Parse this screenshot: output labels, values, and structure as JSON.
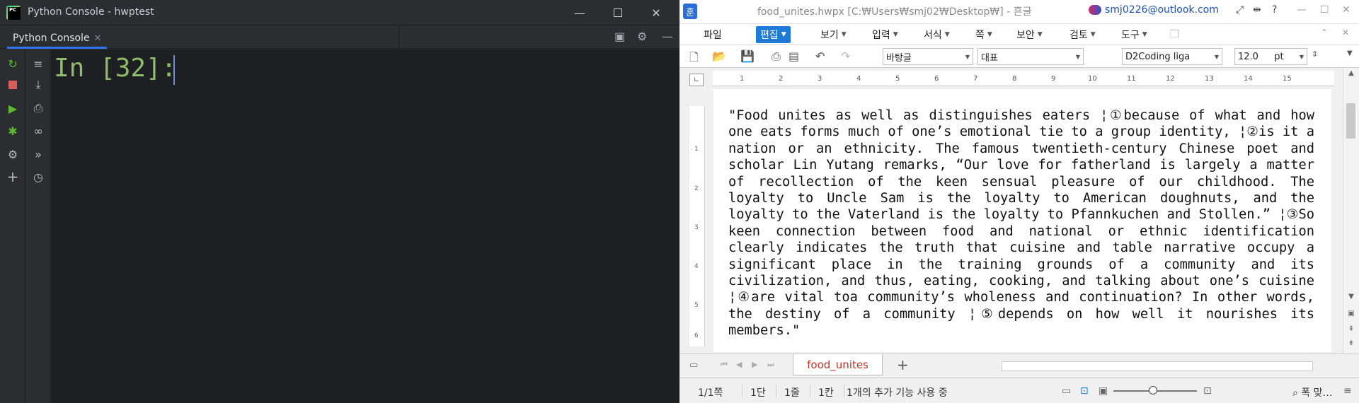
{
  "pycharm": {
    "window_title": "Python Console - hwptest",
    "tab_label": "Python Console",
    "prompt": "In [32]:",
    "colors": {
      "bg": "#2b2d30",
      "editor_bg": "#1e1f22",
      "prompt": "#8fbc6a",
      "run": "#5fb832"
    },
    "left_tools": [
      "rerun-icon",
      "stop-icon",
      "run-icon",
      "debug-icon",
      "settings-icon",
      "add-icon"
    ],
    "second_tools": [
      "soft-wrap-icon",
      "scroll-to-end-icon",
      "print-icon",
      "glasses-icon",
      "execute-icon",
      "history-icon"
    ]
  },
  "hwp": {
    "title": "food_unites.hwpx [C:₩Users₩smj02₩Desktop₩] - 흔글",
    "user": "smj0226@outlook.com",
    "menus": [
      "파일",
      "편집",
      "보기",
      "입력",
      "서식",
      "쪽",
      "보안",
      "검토",
      "도구"
    ],
    "active_menu": "편집",
    "toolbar": {
      "style": "바탕글",
      "font_group": "대표",
      "font": "D2Coding liga",
      "size": "12.0",
      "unit": "pt"
    },
    "ruler_ticks": [
      "1",
      "2",
      "3",
      "4",
      "5",
      "6",
      "7",
      "8",
      "9",
      "10",
      "11",
      "12",
      "13",
      "14",
      "15"
    ],
    "vruler_ticks": [
      "1",
      "2",
      "3",
      "4",
      "5",
      "6"
    ],
    "document_text": "\"Food unites as well as distinguishes eaters ¦①because of what and how one eats forms much of one’s emotional tie to a group identity, ¦②is it a nation or an ethnicity. The famous twentieth-century Chinese poet and scholar Lin Yutang remarks, “Our love for fatherland is largely a matter of recollection of the keen sensual pleasure of our childhood. The loyalty to Uncle Sam is the loyalty to American doughnuts, and the loyalty to the Vaterland is the loyalty to Pfannkuchen and Stollen.” ¦③So keen connection between food and national or ethnic identification clearly indicates the truth that cuisine and table narrative occupy a significant place in the training grounds of a community and its civilization, and thus, eating, cooking, and talking about one’s cuisine ¦④are vital toa community’s wholeness and continuation? In other words, the destiny of a community ¦⑤depends on how well it nourishes its members.\"",
    "sheet_tab": "food_unites",
    "status": {
      "page": "1/1쪽",
      "section": "1단",
      "line": "1줄",
      "col": "1칸",
      "message": "1개의 추가 기능 사용 중",
      "zoom": "폭 맞…"
    },
    "colors": {
      "accent": "#1f7bd8",
      "sheet_tab_text": "#c6322a",
      "user_text": "#1a4fb8"
    }
  }
}
